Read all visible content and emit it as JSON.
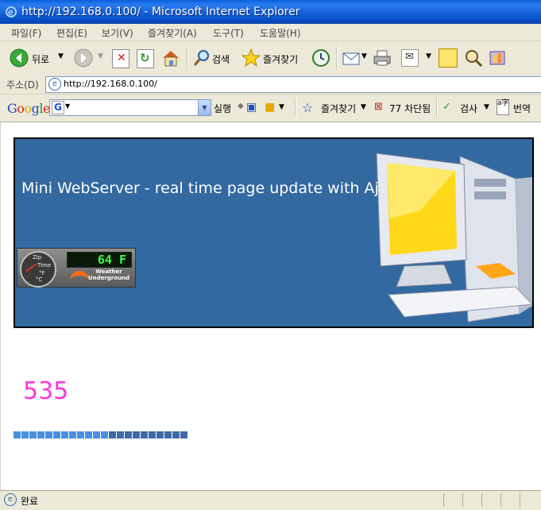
{
  "window": {
    "title": "http://192.168.0.100/ - Microsoft Internet Explorer"
  },
  "menu": {
    "items": [
      "파일(F)",
      "편집(E)",
      "보기(V)",
      "즐겨찾기(A)",
      "도구(T)",
      "도움말(H)"
    ]
  },
  "toolbar": {
    "back_label": "뒤로",
    "search_label": "검색",
    "favorites_label": "즐겨찾기"
  },
  "address": {
    "label": "주소(D)",
    "url": "http://192.168.0.100/"
  },
  "google_toolbar": {
    "logo": "Google",
    "search_value": "",
    "search_button": "실행",
    "favorites_label": "즐겨찾기",
    "blocked_label": "77 차단됨",
    "spell_label": "검사",
    "translate_label": "번역"
  },
  "page": {
    "banner_title": "Mini WebServer - real time page update with Ajax",
    "weather": {
      "temperature": "64 F",
      "brand": "Weather Underground",
      "dial_labels": [
        "Zip",
        "Time",
        "°F",
        "°C"
      ]
    },
    "counter": "535",
    "progress": {
      "segments": 22,
      "filled": 12
    }
  },
  "status": {
    "text": "완료"
  },
  "colors": {
    "title_bar": "#0a5fd8",
    "banner_bg": "#3269a0",
    "counter": "#ff33dd",
    "progress_filled": "#4a90e2",
    "progress_empty": "#3e6aa8"
  }
}
